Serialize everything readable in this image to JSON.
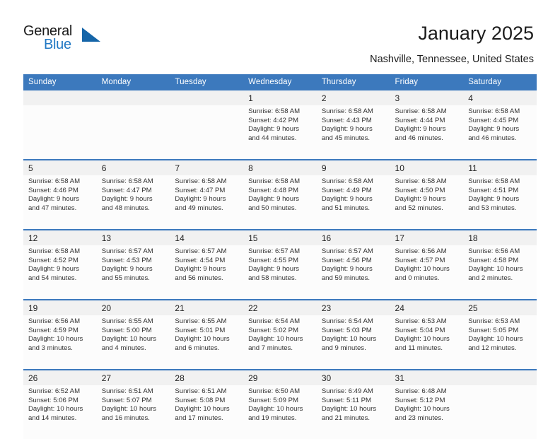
{
  "brand": {
    "name_part1": "General",
    "name_part2": "Blue",
    "triangle_color": "#1565a8",
    "blue_text_color": "#2279c4"
  },
  "header": {
    "title": "January 2025",
    "subtitle": "Nashville, Tennessee, United States",
    "header_bg": "#3c79bd",
    "date_band_bg": "#f1f1f1"
  },
  "weekdays": [
    "Sunday",
    "Monday",
    "Tuesday",
    "Wednesday",
    "Thursday",
    "Friday",
    "Saturday"
  ],
  "weeks": [
    {
      "dates": [
        "",
        "",
        "",
        "1",
        "2",
        "3",
        "4"
      ],
      "cells": [
        {
          "day": "",
          "sunrise": "",
          "sunset": "",
          "daylight_line1": "",
          "daylight_line2": ""
        },
        {
          "day": "",
          "sunrise": "",
          "sunset": "",
          "daylight_line1": "",
          "daylight_line2": ""
        },
        {
          "day": "",
          "sunrise": "",
          "sunset": "",
          "daylight_line1": "",
          "daylight_line2": ""
        },
        {
          "day": "1",
          "sunrise": "Sunrise: 6:58 AM",
          "sunset": "Sunset: 4:42 PM",
          "daylight_line1": "Daylight: 9 hours",
          "daylight_line2": "and 44 minutes."
        },
        {
          "day": "2",
          "sunrise": "Sunrise: 6:58 AM",
          "sunset": "Sunset: 4:43 PM",
          "daylight_line1": "Daylight: 9 hours",
          "daylight_line2": "and 45 minutes."
        },
        {
          "day": "3",
          "sunrise": "Sunrise: 6:58 AM",
          "sunset": "Sunset: 4:44 PM",
          "daylight_line1": "Daylight: 9 hours",
          "daylight_line2": "and 46 minutes."
        },
        {
          "day": "4",
          "sunrise": "Sunrise: 6:58 AM",
          "sunset": "Sunset: 4:45 PM",
          "daylight_line1": "Daylight: 9 hours",
          "daylight_line2": "and 46 minutes."
        }
      ]
    },
    {
      "dates": [
        "5",
        "6",
        "7",
        "8",
        "9",
        "10",
        "11"
      ],
      "cells": [
        {
          "day": "5",
          "sunrise": "Sunrise: 6:58 AM",
          "sunset": "Sunset: 4:46 PM",
          "daylight_line1": "Daylight: 9 hours",
          "daylight_line2": "and 47 minutes."
        },
        {
          "day": "6",
          "sunrise": "Sunrise: 6:58 AM",
          "sunset": "Sunset: 4:47 PM",
          "daylight_line1": "Daylight: 9 hours",
          "daylight_line2": "and 48 minutes."
        },
        {
          "day": "7",
          "sunrise": "Sunrise: 6:58 AM",
          "sunset": "Sunset: 4:47 PM",
          "daylight_line1": "Daylight: 9 hours",
          "daylight_line2": "and 49 minutes."
        },
        {
          "day": "8",
          "sunrise": "Sunrise: 6:58 AM",
          "sunset": "Sunset: 4:48 PM",
          "daylight_line1": "Daylight: 9 hours",
          "daylight_line2": "and 50 minutes."
        },
        {
          "day": "9",
          "sunrise": "Sunrise: 6:58 AM",
          "sunset": "Sunset: 4:49 PM",
          "daylight_line1": "Daylight: 9 hours",
          "daylight_line2": "and 51 minutes."
        },
        {
          "day": "10",
          "sunrise": "Sunrise: 6:58 AM",
          "sunset": "Sunset: 4:50 PM",
          "daylight_line1": "Daylight: 9 hours",
          "daylight_line2": "and 52 minutes."
        },
        {
          "day": "11",
          "sunrise": "Sunrise: 6:58 AM",
          "sunset": "Sunset: 4:51 PM",
          "daylight_line1": "Daylight: 9 hours",
          "daylight_line2": "and 53 minutes."
        }
      ]
    },
    {
      "dates": [
        "12",
        "13",
        "14",
        "15",
        "16",
        "17",
        "18"
      ],
      "cells": [
        {
          "day": "12",
          "sunrise": "Sunrise: 6:58 AM",
          "sunset": "Sunset: 4:52 PM",
          "daylight_line1": "Daylight: 9 hours",
          "daylight_line2": "and 54 minutes."
        },
        {
          "day": "13",
          "sunrise": "Sunrise: 6:57 AM",
          "sunset": "Sunset: 4:53 PM",
          "daylight_line1": "Daylight: 9 hours",
          "daylight_line2": "and 55 minutes."
        },
        {
          "day": "14",
          "sunrise": "Sunrise: 6:57 AM",
          "sunset": "Sunset: 4:54 PM",
          "daylight_line1": "Daylight: 9 hours",
          "daylight_line2": "and 56 minutes."
        },
        {
          "day": "15",
          "sunrise": "Sunrise: 6:57 AM",
          "sunset": "Sunset: 4:55 PM",
          "daylight_line1": "Daylight: 9 hours",
          "daylight_line2": "and 58 minutes."
        },
        {
          "day": "16",
          "sunrise": "Sunrise: 6:57 AM",
          "sunset": "Sunset: 4:56 PM",
          "daylight_line1": "Daylight: 9 hours",
          "daylight_line2": "and 59 minutes."
        },
        {
          "day": "17",
          "sunrise": "Sunrise: 6:56 AM",
          "sunset": "Sunset: 4:57 PM",
          "daylight_line1": "Daylight: 10 hours",
          "daylight_line2": "and 0 minutes."
        },
        {
          "day": "18",
          "sunrise": "Sunrise: 6:56 AM",
          "sunset": "Sunset: 4:58 PM",
          "daylight_line1": "Daylight: 10 hours",
          "daylight_line2": "and 2 minutes."
        }
      ]
    },
    {
      "dates": [
        "19",
        "20",
        "21",
        "22",
        "23",
        "24",
        "25"
      ],
      "cells": [
        {
          "day": "19",
          "sunrise": "Sunrise: 6:56 AM",
          "sunset": "Sunset: 4:59 PM",
          "daylight_line1": "Daylight: 10 hours",
          "daylight_line2": "and 3 minutes."
        },
        {
          "day": "20",
          "sunrise": "Sunrise: 6:55 AM",
          "sunset": "Sunset: 5:00 PM",
          "daylight_line1": "Daylight: 10 hours",
          "daylight_line2": "and 4 minutes."
        },
        {
          "day": "21",
          "sunrise": "Sunrise: 6:55 AM",
          "sunset": "Sunset: 5:01 PM",
          "daylight_line1": "Daylight: 10 hours",
          "daylight_line2": "and 6 minutes."
        },
        {
          "day": "22",
          "sunrise": "Sunrise: 6:54 AM",
          "sunset": "Sunset: 5:02 PM",
          "daylight_line1": "Daylight: 10 hours",
          "daylight_line2": "and 7 minutes."
        },
        {
          "day": "23",
          "sunrise": "Sunrise: 6:54 AM",
          "sunset": "Sunset: 5:03 PM",
          "daylight_line1": "Daylight: 10 hours",
          "daylight_line2": "and 9 minutes."
        },
        {
          "day": "24",
          "sunrise": "Sunrise: 6:53 AM",
          "sunset": "Sunset: 5:04 PM",
          "daylight_line1": "Daylight: 10 hours",
          "daylight_line2": "and 11 minutes."
        },
        {
          "day": "25",
          "sunrise": "Sunrise: 6:53 AM",
          "sunset": "Sunset: 5:05 PM",
          "daylight_line1": "Daylight: 10 hours",
          "daylight_line2": "and 12 minutes."
        }
      ]
    },
    {
      "dates": [
        "26",
        "27",
        "28",
        "29",
        "30",
        "31",
        ""
      ],
      "cells": [
        {
          "day": "26",
          "sunrise": "Sunrise: 6:52 AM",
          "sunset": "Sunset: 5:06 PM",
          "daylight_line1": "Daylight: 10 hours",
          "daylight_line2": "and 14 minutes."
        },
        {
          "day": "27",
          "sunrise": "Sunrise: 6:51 AM",
          "sunset": "Sunset: 5:07 PM",
          "daylight_line1": "Daylight: 10 hours",
          "daylight_line2": "and 16 minutes."
        },
        {
          "day": "28",
          "sunrise": "Sunrise: 6:51 AM",
          "sunset": "Sunset: 5:08 PM",
          "daylight_line1": "Daylight: 10 hours",
          "daylight_line2": "and 17 minutes."
        },
        {
          "day": "29",
          "sunrise": "Sunrise: 6:50 AM",
          "sunset": "Sunset: 5:09 PM",
          "daylight_line1": "Daylight: 10 hours",
          "daylight_line2": "and 19 minutes."
        },
        {
          "day": "30",
          "sunrise": "Sunrise: 6:49 AM",
          "sunset": "Sunset: 5:11 PM",
          "daylight_line1": "Daylight: 10 hours",
          "daylight_line2": "and 21 minutes."
        },
        {
          "day": "31",
          "sunrise": "Sunrise: 6:48 AM",
          "sunset": "Sunset: 5:12 PM",
          "daylight_line1": "Daylight: 10 hours",
          "daylight_line2": "and 23 minutes."
        },
        {
          "day": "",
          "sunrise": "",
          "sunset": "",
          "daylight_line1": "",
          "daylight_line2": ""
        }
      ]
    }
  ]
}
